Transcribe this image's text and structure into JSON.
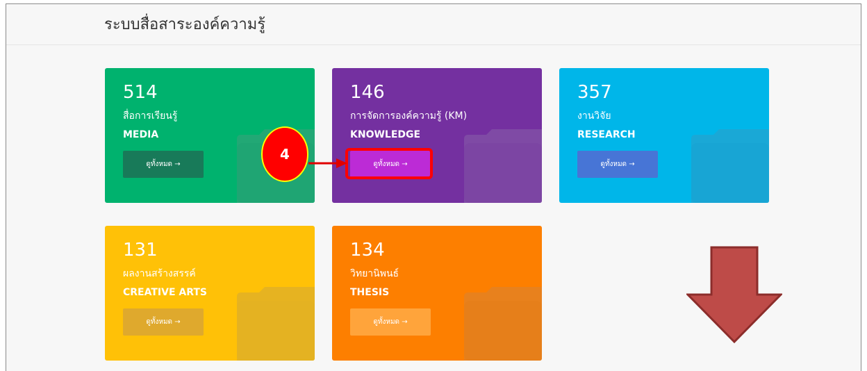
{
  "header": {
    "title": "ระบบสื่อสาระองค์ความรู้"
  },
  "cards": [
    {
      "count": "514",
      "title_th": "สื่อการเรียนรู้",
      "title_en": "MEDIA",
      "button_label": "ดูทั้งหมด →",
      "color": "#00b26e",
      "button_color": "#187a59",
      "folder_color": "#22a875"
    },
    {
      "count": "146",
      "title_th": "การจัดการองค์ความรู้ (KM)",
      "title_en": "KNOWLEDGE",
      "button_label": "ดูทั้งหมด →",
      "color": "#7430a0",
      "button_color": "#bc2bd6",
      "folder_color": "#7f4aa5"
    },
    {
      "count": "357",
      "title_th": "งานวิจัย",
      "title_en": "RESEARCH",
      "button_label": "ดูทั้งหมด →",
      "color": "#00b6e9",
      "button_color": "#4775d6",
      "folder_color": "#1aa8d6"
    },
    {
      "count": "131",
      "title_th": "ผลงานสร้างสรรค์",
      "title_en": "CREATIVE ARTS",
      "button_label": "ดูทั้งหมด →",
      "color": "#ffc107",
      "button_color": "#dfa92d",
      "folder_color": "#e6b321"
    },
    {
      "count": "134",
      "title_th": "วิทยานิพนธ์",
      "title_en": "THESIS",
      "button_label": "ดูทั้งหมด →",
      "color": "#fd7f00",
      "button_color": "#ffa43b",
      "folder_color": "#e8811d"
    }
  ],
  "annotation": {
    "step_number": "4",
    "arrow_color": "#be4b48"
  }
}
